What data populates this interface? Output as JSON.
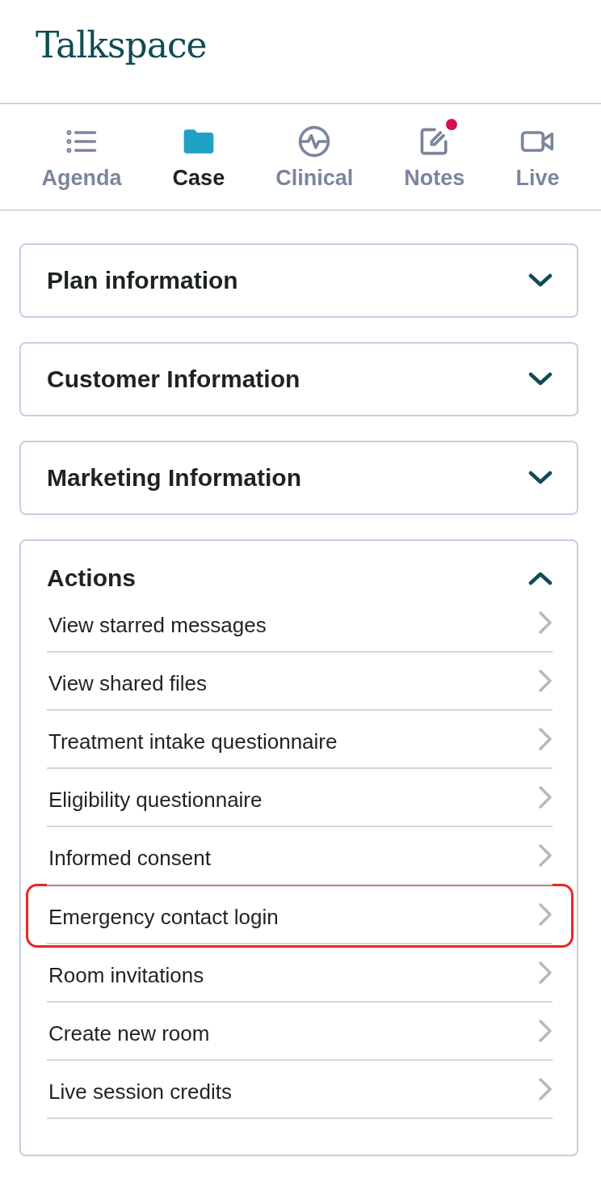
{
  "logo": "Talkspace",
  "tabs": [
    {
      "label": "Agenda",
      "selected": false,
      "badge": false
    },
    {
      "label": "Case",
      "selected": true,
      "badge": false
    },
    {
      "label": "Clinical",
      "selected": false,
      "badge": false
    },
    {
      "label": "Notes",
      "selected": false,
      "badge": true
    },
    {
      "label": "Live",
      "selected": false,
      "badge": false
    }
  ],
  "sections": [
    {
      "title": "Plan information",
      "expanded": false
    },
    {
      "title": "Customer Information",
      "expanded": false
    },
    {
      "title": "Marketing Information",
      "expanded": false
    },
    {
      "title": "Actions",
      "expanded": true,
      "items": [
        {
          "label": "View starred messages",
          "highlighted": false
        },
        {
          "label": "View shared files",
          "highlighted": false
        },
        {
          "label": "Treatment intake questionnaire",
          "highlighted": false
        },
        {
          "label": "Eligibility questionnaire",
          "highlighted": false
        },
        {
          "label": "Informed consent",
          "highlighted": false
        },
        {
          "label": "Emergency contact login",
          "highlighted": true
        },
        {
          "label": "Room invitations",
          "highlighted": false
        },
        {
          "label": "Create new room",
          "highlighted": false
        },
        {
          "label": "Live session credits",
          "highlighted": false
        }
      ]
    }
  ]
}
